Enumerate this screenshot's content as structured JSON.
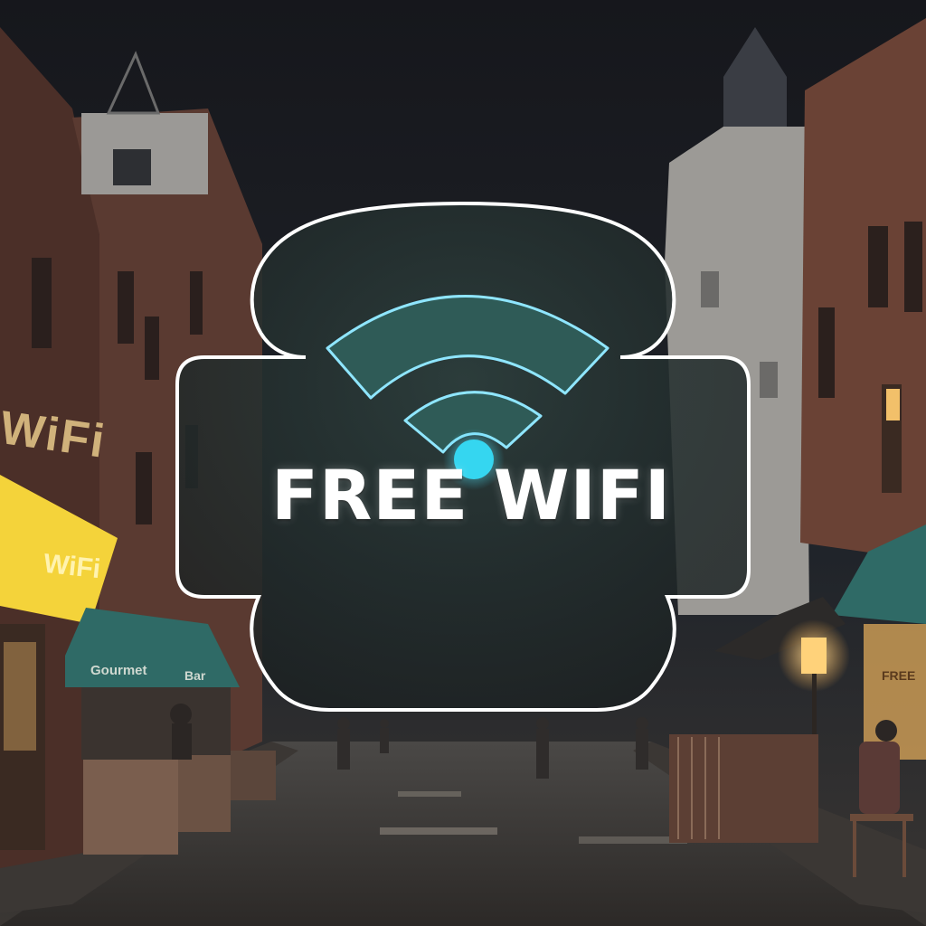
{
  "sign": {
    "headline": "FREE WIFI",
    "icon": "wifi-icon"
  },
  "shop_signs": {
    "left_building": "WiFi",
    "yellow_banner": "WiFi",
    "awning_left": "Gourmet",
    "awning_left_small": "Bar",
    "right_cafe": "FREE"
  },
  "colors": {
    "sky": "#17181d",
    "badge_fill": "#22302f",
    "badge_outline": "#ffffff",
    "wifi_teal": "#2f5b57",
    "wifi_glow": "#8fe6ff",
    "wifi_dot": "#35d6f0",
    "yellow_banner": "#f4d33a",
    "lamp_glow": "#ffd27a"
  }
}
